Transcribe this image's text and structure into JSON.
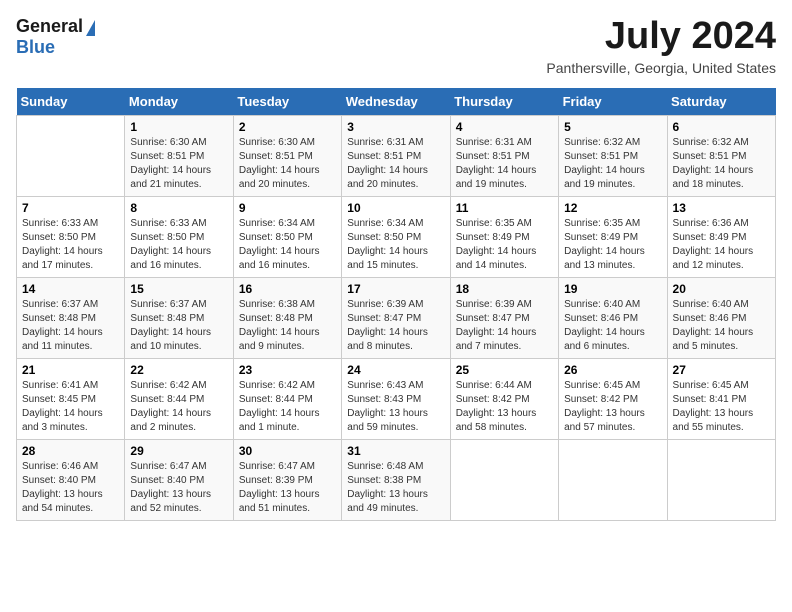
{
  "logo": {
    "line1": "General",
    "line2": "Blue"
  },
  "header": {
    "month_year": "July 2024",
    "location": "Panthersville, Georgia, United States"
  },
  "weekdays": [
    "Sunday",
    "Monday",
    "Tuesday",
    "Wednesday",
    "Thursday",
    "Friday",
    "Saturday"
  ],
  "weeks": [
    [
      {
        "day": "",
        "sunrise": "",
        "sunset": "",
        "daylight": ""
      },
      {
        "day": "1",
        "sunrise": "Sunrise: 6:30 AM",
        "sunset": "Sunset: 8:51 PM",
        "daylight": "Daylight: 14 hours and 21 minutes."
      },
      {
        "day": "2",
        "sunrise": "Sunrise: 6:30 AM",
        "sunset": "Sunset: 8:51 PM",
        "daylight": "Daylight: 14 hours and 20 minutes."
      },
      {
        "day": "3",
        "sunrise": "Sunrise: 6:31 AM",
        "sunset": "Sunset: 8:51 PM",
        "daylight": "Daylight: 14 hours and 20 minutes."
      },
      {
        "day": "4",
        "sunrise": "Sunrise: 6:31 AM",
        "sunset": "Sunset: 8:51 PM",
        "daylight": "Daylight: 14 hours and 19 minutes."
      },
      {
        "day": "5",
        "sunrise": "Sunrise: 6:32 AM",
        "sunset": "Sunset: 8:51 PM",
        "daylight": "Daylight: 14 hours and 19 minutes."
      },
      {
        "day": "6",
        "sunrise": "Sunrise: 6:32 AM",
        "sunset": "Sunset: 8:51 PM",
        "daylight": "Daylight: 14 hours and 18 minutes."
      }
    ],
    [
      {
        "day": "7",
        "sunrise": "Sunrise: 6:33 AM",
        "sunset": "Sunset: 8:50 PM",
        "daylight": "Daylight: 14 hours and 17 minutes."
      },
      {
        "day": "8",
        "sunrise": "Sunrise: 6:33 AM",
        "sunset": "Sunset: 8:50 PM",
        "daylight": "Daylight: 14 hours and 16 minutes."
      },
      {
        "day": "9",
        "sunrise": "Sunrise: 6:34 AM",
        "sunset": "Sunset: 8:50 PM",
        "daylight": "Daylight: 14 hours and 16 minutes."
      },
      {
        "day": "10",
        "sunrise": "Sunrise: 6:34 AM",
        "sunset": "Sunset: 8:50 PM",
        "daylight": "Daylight: 14 hours and 15 minutes."
      },
      {
        "day": "11",
        "sunrise": "Sunrise: 6:35 AM",
        "sunset": "Sunset: 8:49 PM",
        "daylight": "Daylight: 14 hours and 14 minutes."
      },
      {
        "day": "12",
        "sunrise": "Sunrise: 6:35 AM",
        "sunset": "Sunset: 8:49 PM",
        "daylight": "Daylight: 14 hours and 13 minutes."
      },
      {
        "day": "13",
        "sunrise": "Sunrise: 6:36 AM",
        "sunset": "Sunset: 8:49 PM",
        "daylight": "Daylight: 14 hours and 12 minutes."
      }
    ],
    [
      {
        "day": "14",
        "sunrise": "Sunrise: 6:37 AM",
        "sunset": "Sunset: 8:48 PM",
        "daylight": "Daylight: 14 hours and 11 minutes."
      },
      {
        "day": "15",
        "sunrise": "Sunrise: 6:37 AM",
        "sunset": "Sunset: 8:48 PM",
        "daylight": "Daylight: 14 hours and 10 minutes."
      },
      {
        "day": "16",
        "sunrise": "Sunrise: 6:38 AM",
        "sunset": "Sunset: 8:48 PM",
        "daylight": "Daylight: 14 hours and 9 minutes."
      },
      {
        "day": "17",
        "sunrise": "Sunrise: 6:39 AM",
        "sunset": "Sunset: 8:47 PM",
        "daylight": "Daylight: 14 hours and 8 minutes."
      },
      {
        "day": "18",
        "sunrise": "Sunrise: 6:39 AM",
        "sunset": "Sunset: 8:47 PM",
        "daylight": "Daylight: 14 hours and 7 minutes."
      },
      {
        "day": "19",
        "sunrise": "Sunrise: 6:40 AM",
        "sunset": "Sunset: 8:46 PM",
        "daylight": "Daylight: 14 hours and 6 minutes."
      },
      {
        "day": "20",
        "sunrise": "Sunrise: 6:40 AM",
        "sunset": "Sunset: 8:46 PM",
        "daylight": "Daylight: 14 hours and 5 minutes."
      }
    ],
    [
      {
        "day": "21",
        "sunrise": "Sunrise: 6:41 AM",
        "sunset": "Sunset: 8:45 PM",
        "daylight": "Daylight: 14 hours and 3 minutes."
      },
      {
        "day": "22",
        "sunrise": "Sunrise: 6:42 AM",
        "sunset": "Sunset: 8:44 PM",
        "daylight": "Daylight: 14 hours and 2 minutes."
      },
      {
        "day": "23",
        "sunrise": "Sunrise: 6:42 AM",
        "sunset": "Sunset: 8:44 PM",
        "daylight": "Daylight: 14 hours and 1 minute."
      },
      {
        "day": "24",
        "sunrise": "Sunrise: 6:43 AM",
        "sunset": "Sunset: 8:43 PM",
        "daylight": "Daylight: 13 hours and 59 minutes."
      },
      {
        "day": "25",
        "sunrise": "Sunrise: 6:44 AM",
        "sunset": "Sunset: 8:42 PM",
        "daylight": "Daylight: 13 hours and 58 minutes."
      },
      {
        "day": "26",
        "sunrise": "Sunrise: 6:45 AM",
        "sunset": "Sunset: 8:42 PM",
        "daylight": "Daylight: 13 hours and 57 minutes."
      },
      {
        "day": "27",
        "sunrise": "Sunrise: 6:45 AM",
        "sunset": "Sunset: 8:41 PM",
        "daylight": "Daylight: 13 hours and 55 minutes."
      }
    ],
    [
      {
        "day": "28",
        "sunrise": "Sunrise: 6:46 AM",
        "sunset": "Sunset: 8:40 PM",
        "daylight": "Daylight: 13 hours and 54 minutes."
      },
      {
        "day": "29",
        "sunrise": "Sunrise: 6:47 AM",
        "sunset": "Sunset: 8:40 PM",
        "daylight": "Daylight: 13 hours and 52 minutes."
      },
      {
        "day": "30",
        "sunrise": "Sunrise: 6:47 AM",
        "sunset": "Sunset: 8:39 PM",
        "daylight": "Daylight: 13 hours and 51 minutes."
      },
      {
        "day": "31",
        "sunrise": "Sunrise: 6:48 AM",
        "sunset": "Sunset: 8:38 PM",
        "daylight": "Daylight: 13 hours and 49 minutes."
      },
      {
        "day": "",
        "sunrise": "",
        "sunset": "",
        "daylight": ""
      },
      {
        "day": "",
        "sunrise": "",
        "sunset": "",
        "daylight": ""
      },
      {
        "day": "",
        "sunrise": "",
        "sunset": "",
        "daylight": ""
      }
    ]
  ]
}
